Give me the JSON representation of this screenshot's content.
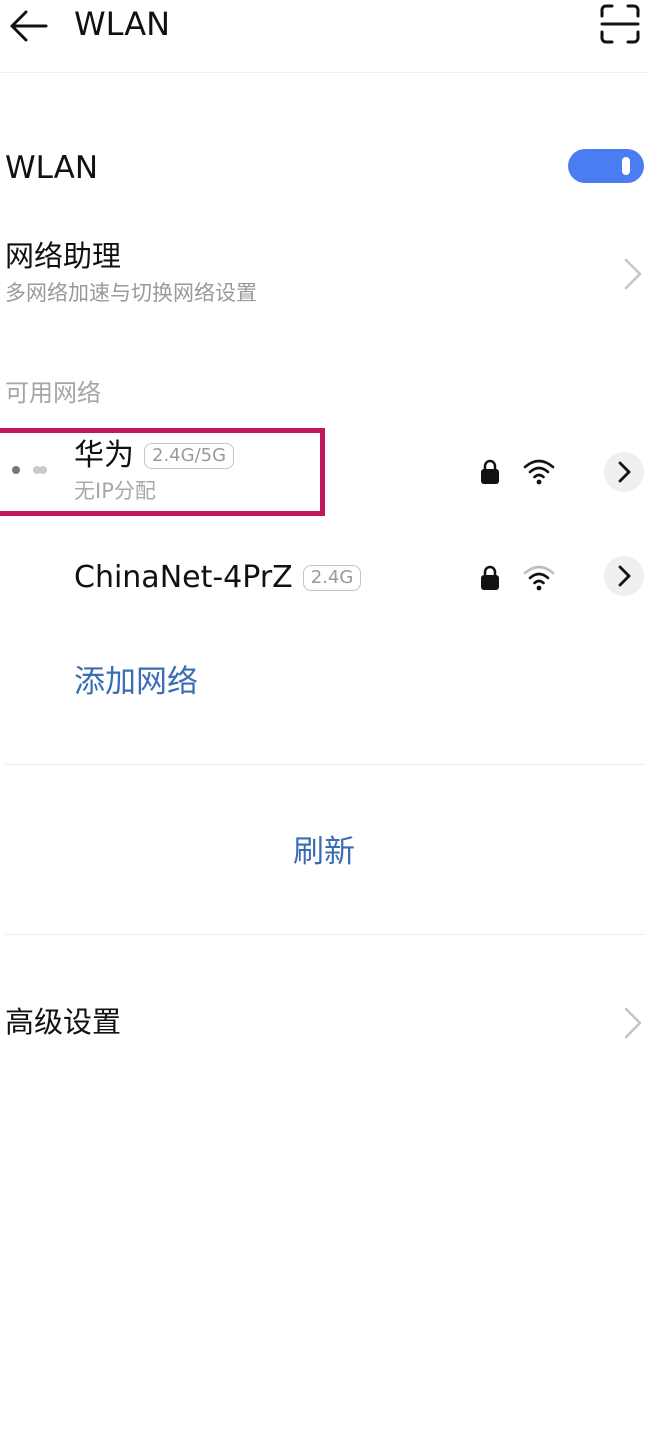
{
  "header": {
    "title": "WLAN",
    "back_icon": "arrow-left-icon",
    "scan_icon": "scan-frame-icon"
  },
  "wlan_toggle": {
    "label": "WLAN",
    "enabled": true,
    "accent_color": "#4a7cf2"
  },
  "network_assistant": {
    "title": "网络助理",
    "subtitle": "多网络加速与切换网络设置"
  },
  "available_networks": {
    "section_label": "可用网络",
    "items": [
      {
        "ssid": "华为",
        "band": "2.4G/5G",
        "status": "无IP分配",
        "secured": true,
        "highlighted": true
      },
      {
        "ssid": "ChinaNet-4PrZ",
        "band": "2.4G",
        "status": "",
        "secured": true,
        "highlighted": false
      }
    ],
    "add_network_label": "添加网络"
  },
  "refresh_label": "刷新",
  "advanced_settings": {
    "title": "高级设置"
  },
  "colors": {
    "link": "#3b6db5",
    "highlight_border": "#c2185b"
  }
}
